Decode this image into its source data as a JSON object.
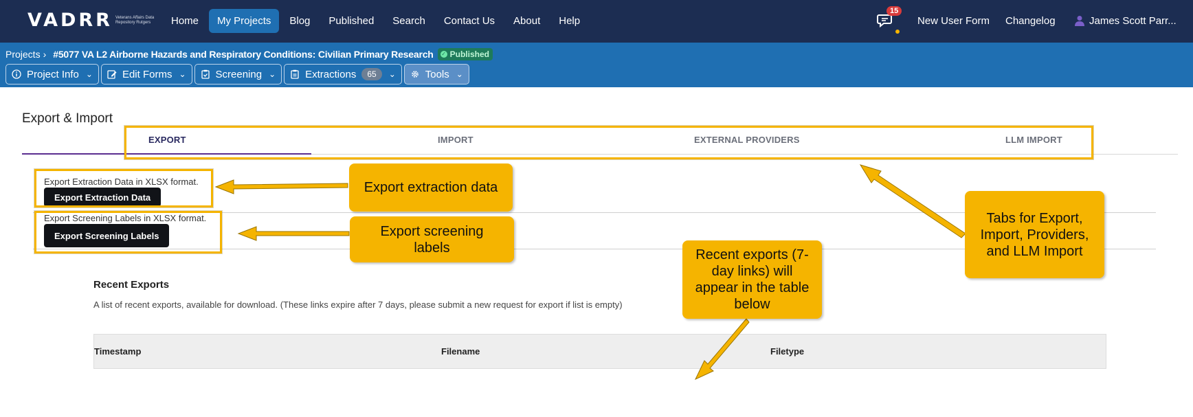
{
  "topnav": {
    "logo": {
      "word": "VADRR",
      "sub": "Veterans Affairs Data Repository Rutgers"
    },
    "links": [
      {
        "label": "Home",
        "active": false
      },
      {
        "label": "My Projects",
        "active": true
      },
      {
        "label": "Blog",
        "active": false
      },
      {
        "label": "Published",
        "active": false
      },
      {
        "label": "Search",
        "active": false
      },
      {
        "label": "Contact Us",
        "active": false
      },
      {
        "label": "About",
        "active": false
      },
      {
        "label": "Help",
        "active": false
      }
    ],
    "notifications_count": "15",
    "new_user_form": "New User Form",
    "changelog": "Changelog",
    "user_name": "James Scott Parr..."
  },
  "projectbar": {
    "crumb_projects": "Projects",
    "crumb_sep": "›",
    "project_title": "#5077 VA L2 Airborne Hazards and Respiratory Conditions: Civilian Primary Research",
    "status": "Published",
    "tools": {
      "project_info": "Project Info",
      "edit_forms": "Edit Forms",
      "screening": "Screening",
      "extractions": "Extractions",
      "extractions_count": "65",
      "tools": "Tools"
    }
  },
  "page": {
    "title": "Export & Import",
    "tabs": [
      "EXPORT",
      "IMPORT",
      "EXTERNAL PROVIDERS",
      "LLM IMPORT"
    ],
    "active_tab": "EXPORT",
    "export_extraction": {
      "text": "Export Extraction Data in XLSX format.",
      "button": "Export Extraction Data"
    },
    "export_screening": {
      "text": "Export Screening Labels in XLSX format.",
      "button": "Export Screening Labels"
    },
    "recent": {
      "title": "Recent Exports",
      "description": "A list of recent exports, available for download. (These links expire after 7 days, please submit a new request for export if list is empty)",
      "columns": [
        "Timestamp",
        "Filename",
        "Filetype"
      ]
    }
  },
  "annotations": {
    "callout_extraction": "Export extraction data",
    "callout_screening_line1": "Export screening",
    "callout_screening_line2": "labels",
    "callout_recent_line1": "Recent exports (7-",
    "callout_recent_line2": "day links) will",
    "callout_recent_line3": "appear in the table",
    "callout_recent_line4": "below",
    "callout_tabs_line1": "Tabs for Export,",
    "callout_tabs_line2": "Import, Providers,",
    "callout_tabs_line3": "and LLM Import",
    "color": "#f5b400"
  },
  "colors": {
    "nav_bg": "#1c2d52",
    "projbar_bg": "#1f6fb2",
    "active_tab_underline": "#5b2d8f"
  }
}
